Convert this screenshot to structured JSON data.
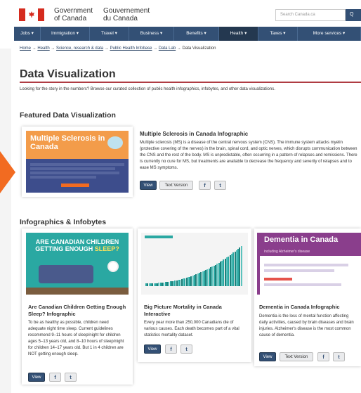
{
  "header": {
    "gov_en_line1": "Government",
    "gov_en_line2": "of Canada",
    "gov_fr_line1": "Gouvernement",
    "gov_fr_line2": "du Canada",
    "search_placeholder": "Search Canada.ca",
    "search_button": "Q"
  },
  "nav": [
    {
      "label": "Jobs ▾"
    },
    {
      "label": "Immigration ▾"
    },
    {
      "label": "Travel ▾"
    },
    {
      "label": "Business ▾"
    },
    {
      "label": "Benefits ▾"
    },
    {
      "label": "Health ▾"
    },
    {
      "label": "Taxes ▾"
    },
    {
      "label": "More services ▾"
    }
  ],
  "breadcrumb": {
    "items": [
      "Home",
      "Health",
      "Science, research & data",
      "Public Health Infobase",
      "Data Lab"
    ],
    "current": "Data Visualization",
    "separator": "→"
  },
  "page": {
    "title": "Data Visualization",
    "intro": "Looking for the story in the numbers? Browse our curated collection of public health infographics, infobytes, and other data visualizations."
  },
  "featured": {
    "heading": "Featured Data Visualization",
    "image_title": "Multiple Sclerosis in Canada",
    "title": "Multiple Sclerosis in Canada Infographic",
    "description": "Multiple sclerosis (MS) is a disease of the central nervous system (CNS). The immune system attacks myelin (protective covering of the nerves) in the brain, spinal cord, and optic nerves, which disrupts communication between the CNS and the rest of the body. MS is unpredictable, often occurring in a pattern of relapses and remissions. There is currently no cure for MS, but treatments are available to decrease the frequency and severity of relapses and to ease MS symptoms.",
    "view_label": "View",
    "text_version_label": "Text Version"
  },
  "infographics": {
    "heading": "Infographics & Infobytes",
    "cards": [
      {
        "image_title_a": "ARE CANADIAN CHILDREN",
        "image_title_b": "GETTING ENOUGH ",
        "image_title_c": "SLEEP?",
        "title": "Are Canadian Children Getting Enough Sleep? Infographic",
        "description": "To be as healthy as possible, children need adequate night time sleep. Current guidelines recommend 9–11 hours of sleep/night for children ages 5–13 years old, and 8–10 hours of sleep/night for children 14–17 years old. But 1 in 4 children are NOT getting enough sleep.",
        "view_label": "View"
      },
      {
        "title": "Big Picture Mortality in Canada Interactive",
        "description": "Every year more than 250,000 Canadians die of various causes. Each death becomes part of a vital statistics mortality dataset.",
        "view_label": "View"
      },
      {
        "image_title": "Dementia in Canada",
        "image_subtitle": "including Alzheimer's disease",
        "title": "Dementia in Canada Infographic",
        "description": "Dementia is the loss of mental function affecting daily activities, caused by brain diseases and brain injuries. Alzheimer's disease is the most common cause of dementia.",
        "view_label": "View",
        "text_version_label": "Text Version"
      }
    ]
  },
  "icons": {
    "facebook": "f",
    "twitter": "t"
  },
  "colors": {
    "nav_blue": "#335075",
    "accent_red": "#af3c43",
    "orange": "#f26b21",
    "teal": "#2aa8a2",
    "purple": "#8a3e8c"
  }
}
